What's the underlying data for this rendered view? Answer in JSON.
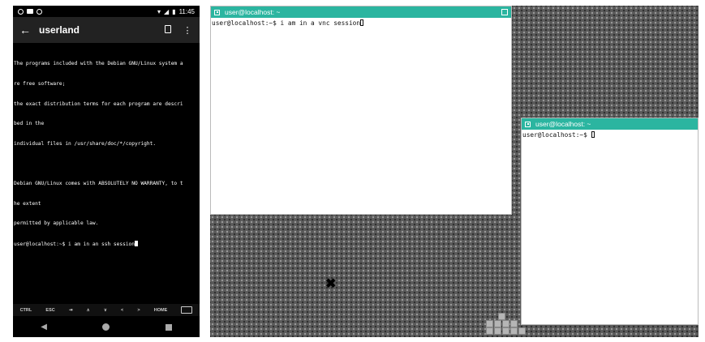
{
  "phone": {
    "status_time": "11:45",
    "app_title": "userland",
    "terminal_lines": [
      "The programs included with the Debian GNU/Linux system a",
      "re free software;",
      "the exact distribution terms for each program are descri",
      "bed in the",
      "individual files in /usr/share/doc/*/copyright.",
      "",
      "Debian GNU/Linux comes with ABSOLUTELY NO WARRANTY, to t",
      "he extent",
      "permitted by applicable law.",
      "user@localhost:~$ i am in an ssh session"
    ],
    "extra_keys": [
      "CTRL",
      "ESC",
      "⇥",
      "∧",
      "∨",
      "<",
      ">",
      "HOME"
    ]
  },
  "vnc": {
    "window1": {
      "title": "user@localhost: ~",
      "line": "user@localhost:~$ i am in a vnc session"
    },
    "window2": {
      "title": "user@localhost: ~",
      "line": "user@localhost:~$ "
    }
  },
  "colors": {
    "titlebar": "#2bb5a0",
    "phone_bg": "#000000",
    "phone_toolbar": "#222222"
  }
}
